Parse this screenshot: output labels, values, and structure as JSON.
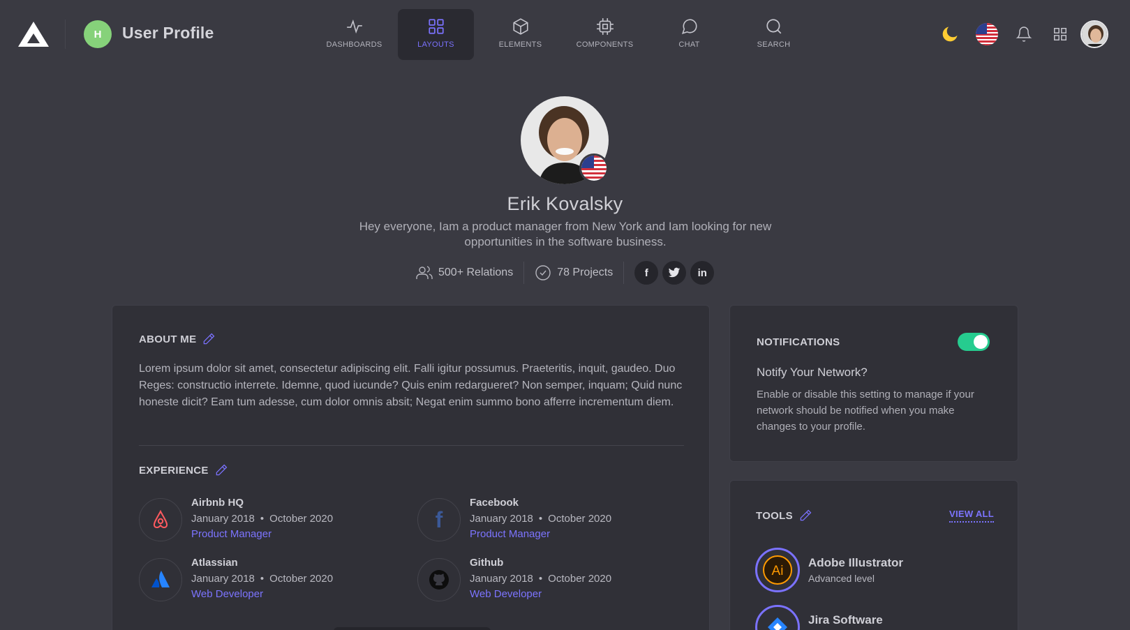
{
  "header": {
    "badge_letter": "H",
    "title": "User Profile"
  },
  "nav": {
    "items": [
      {
        "label": "DASHBOARDS",
        "icon": "pulse-icon"
      },
      {
        "label": "LAYOUTS",
        "icon": "grid-layout-icon",
        "active": true
      },
      {
        "label": "ELEMENTS",
        "icon": "cube-icon"
      },
      {
        "label": "COMPONENTS",
        "icon": "chip-icon"
      },
      {
        "label": "CHAT",
        "icon": "chat-bubble-icon"
      },
      {
        "label": "SEARCH",
        "icon": "search-icon"
      }
    ]
  },
  "toolbar_icons": [
    "moon-icon",
    "us-flag-icon",
    "bell-icon",
    "apps-grid-icon",
    "user-avatar"
  ],
  "profile": {
    "name": "Erik Kovalsky",
    "bio": "Hey everyone, Iam a product manager from New York and Iam looking for new opportunities in the software business.",
    "relations": "500+ Relations",
    "projects": "78 Projects",
    "social": [
      "facebook-icon",
      "twitter-icon",
      "linkedin-icon"
    ]
  },
  "about": {
    "heading": "ABOUT ME",
    "text": "Lorem ipsum dolor sit amet, consectetur adipiscing elit. Falli igitur possumus. Praeteritis, inquit, gaudeo. Duo Reges: constructio interrete. Idemne, quod iucunde? Quis enim redargueret? Non semper, inquam; Quid nunc honeste dicit? Eam tum adesse, cum dolor omnis absit; Negat enim summo bono afferre incrementum diem."
  },
  "experience": {
    "heading": "EXPERIENCE",
    "items": [
      {
        "company": "Airbnb HQ",
        "start": "January 2018",
        "end": "October 2020",
        "role": "Product Manager",
        "icon": "airbnb-icon"
      },
      {
        "company": "Facebook",
        "start": "January 2018",
        "end": "October 2020",
        "role": "Product Manager",
        "icon": "facebook-icon"
      },
      {
        "company": "Atlassian",
        "start": "January 2018",
        "end": "October 2020",
        "role": "Web Developer",
        "icon": "atlassian-icon"
      },
      {
        "company": "Github",
        "start": "January 2018",
        "end": "October 2020",
        "role": "Web Developer",
        "icon": "github-icon"
      }
    ],
    "separator": "•"
  },
  "notifications": {
    "heading": "NOTIFICATIONS",
    "enabled": true,
    "subtitle": "Notify Your Network?",
    "description": "Enable or disable this setting to manage if your network should be notified when you make changes to your profile."
  },
  "tools": {
    "heading": "TOOLS",
    "view_all": "VIEW ALL",
    "items": [
      {
        "name": "Adobe Illustrator",
        "level": "Advanced level",
        "icon": "illustrator-icon"
      },
      {
        "name": "Jira Software",
        "level": "",
        "icon": "jira-icon"
      }
    ]
  },
  "colors": {
    "background": "#3a3a42",
    "card": "#303037",
    "accent": "#7b72ff",
    "toggle_on": "#26cc8f",
    "badge": "#86d27a"
  }
}
